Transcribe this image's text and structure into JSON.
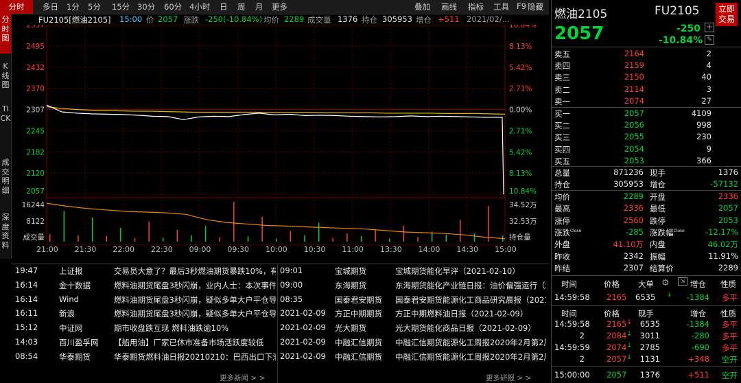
{
  "toolbar": {
    "periods": [
      "分时",
      "多日",
      "1分",
      "5分",
      "15分",
      "30分",
      "60分",
      "4小时",
      "日",
      "周",
      "月",
      "更多"
    ],
    "active_period": "分时",
    "tools": [
      "叠加",
      "画线",
      "指标",
      "工具",
      "F9",
      "隐藏"
    ]
  },
  "sidetabs": [
    "分时图",
    "K线图",
    "TICK",
    "成交明细",
    "深度资料"
  ],
  "infobar": {
    "symbol": "FU2105[燃油2105]",
    "time": "15:00",
    "price_label": "价",
    "price": "2057",
    "change_label": "涨跌",
    "change": "-250(-10.84%)",
    "avg_label": "均价",
    "avg": "2289",
    "volume_label": "成交量",
    "volume": "1376",
    "oi_label": "持仓",
    "oi": "305953",
    "oi_change_label": "增仓",
    "oi_change": "+511",
    "date": "2021/02/..."
  },
  "chart_data": {
    "type": "line",
    "prev_settle": 2307,
    "price_axis": [
      "2557",
      "2495",
      "2432",
      "2370",
      "2307",
      "2245",
      "2182",
      "2120",
      "2057"
    ],
    "pct_axis": [
      "10.84%",
      "8.13%",
      "5.42%",
      "2.71%",
      "0.00%",
      "2.71%",
      "5.42%",
      "8.13%",
      "10.84%"
    ],
    "volume_axis": [
      "16244",
      "8122",
      "成交量"
    ],
    "oi_axis": [
      "34.52万",
      "32.53万",
      "持仓量"
    ],
    "time_labels": [
      "21:00",
      "21:30",
      "22:00",
      "22:30",
      "09:00",
      "09:30",
      "10:00",
      "10:30",
      "11:00",
      "13:30",
      "14:00",
      "14:30",
      "15:00"
    ],
    "series": [
      {
        "values": [
          2320,
          2300,
          2296,
          2294,
          2293,
          2292,
          2290,
          2287,
          2286,
          2277,
          2285,
          2287,
          2286,
          2292,
          2296,
          2291,
          2293,
          2289,
          2290,
          2289,
          2287,
          2286,
          2285,
          2286,
          2288,
          2286,
          2287,
          2286,
          2285,
          2284,
          2284,
          2057
        ]
      },
      {
        "values": [
          2315,
          2310,
          2307,
          2305,
          2304,
          2303,
          2302,
          2302,
          2301,
          2300,
          2299,
          2299,
          2299,
          2299,
          2299,
          2298,
          2298,
          2298,
          2298,
          2297,
          2297,
          2297,
          2297,
          2296,
          2296,
          2296,
          2296,
          2295,
          2295,
          2295,
          2294,
          2293
        ]
      }
    ],
    "volume": [
      3000,
      12500,
      2500,
      9800,
      2200,
      5600,
      1400,
      8200,
      1600,
      4800,
      2500,
      6300,
      1800,
      16244,
      2100,
      10200,
      1200,
      4300,
      2600,
      7700,
      1500,
      3400,
      2200,
      5100,
      1300,
      6400,
      1900,
      4000,
      2800,
      9000,
      3300,
      14500,
      2500
    ],
    "volume_colors": [
      "r",
      "g",
      "r",
      "g",
      "r",
      "g",
      "r",
      "r",
      "g",
      "r",
      "g",
      "g",
      "r",
      "r",
      "g",
      "r",
      "g",
      "r",
      "g",
      "g",
      "r",
      "r",
      "g",
      "r",
      "g",
      "r",
      "r",
      "g",
      "g",
      "r",
      "g",
      "r",
      "g"
    ],
    "open_interest": [
      34.9,
      34.7,
      34.55,
      34.45,
      34.35,
      34.3,
      34.25,
      34.15,
      33.8,
      33.6,
      33.5,
      33.4,
      33.35,
      33.3,
      33.25,
      33.2,
      33.15,
      33.05,
      32.95,
      32.9,
      32.85,
      32.75,
      32.6,
      32.5
    ]
  },
  "news_left": [
    {
      "time": "19:47",
      "source": "上证报",
      "title": "交易员大意了？最后3秒燃油期货暴跌10%，有色…"
    },
    {
      "time": "16:14",
      "source": "金十数据",
      "title": "燃料油期货尾盘3秒闪崩，业内人士：本次事件系…"
    },
    {
      "time": "16:14",
      "source": "Wind",
      "title": "燃料油期货尾盘3秒闪崩，疑似多单大户平仓导致…"
    },
    {
      "time": "16:11",
      "source": "新浪",
      "title": "燃料油期货尾盘3秒闪崩，疑似多单大户平仓导致…"
    },
    {
      "time": "15:12",
      "source": "中证网",
      "title": "期市收盘跌互现 燃料油跌逾10%"
    },
    {
      "time": "14:03",
      "source": "百川盈孚网",
      "title": "【船用油】厂家已休市准备市场活跃度较低"
    },
    {
      "time": "08:54",
      "source": "华泰期货",
      "title": "华泰期货燃料油日报20210210：巴西出口下滑…"
    }
  ],
  "news_left_more": "更多新闻 > >",
  "news_right": [
    {
      "time": "09:01",
      "source": "宝城期货",
      "title": "宝城期货能化早评（2021-02-10）"
    },
    {
      "time": "09:00",
      "source": "东海期货",
      "title": "东海期货能化产业链日报：油价偏强运行（2…"
    },
    {
      "time": "08:35",
      "source": "国泰君安期货",
      "title": "国泰君安期货能源化工商品研究晨报（2021…"
    },
    {
      "time": "2021-02-09",
      "source": "方正中期期货",
      "title": "方正中期燃料油日报（2021-02-09）"
    },
    {
      "time": "2021-02-09",
      "source": "光大期货",
      "title": "光大期货能化商品日报（2021-02-09）"
    },
    {
      "time": "2021-02-09",
      "source": "中融汇信期货",
      "title": "中融汇信期货能源化工周报2020年2月第2周…"
    },
    {
      "time": "2021-02-09",
      "source": "中融汇信期货",
      "title": "中融汇信期货能源化工周报2020年2月第2周…"
    }
  ],
  "news_right_more": "更多研报 > >",
  "quote": {
    "name": "燃油2105",
    "code": "FU2105",
    "trade_button": "立即交易",
    "price": "2057",
    "change": "-250",
    "change_pct": "-10.84%",
    "asks": [
      {
        "label": "卖五",
        "price": "2164",
        "vol": "2"
      },
      {
        "label": "卖四",
        "price": "2159",
        "vol": "4"
      },
      {
        "label": "卖三",
        "price": "2150",
        "vol": "40"
      },
      {
        "label": "卖二",
        "price": "2114",
        "vol": "3"
      },
      {
        "label": "卖一",
        "price": "2074",
        "vol": "27"
      }
    ],
    "bids": [
      {
        "label": "买一",
        "price": "2057",
        "vol": "4109"
      },
      {
        "label": "买二",
        "price": "2056",
        "vol": "998"
      },
      {
        "label": "买三",
        "price": "2055",
        "vol": "230"
      },
      {
        "label": "买四",
        "price": "2054",
        "vol": "9"
      },
      {
        "label": "买五",
        "price": "2053",
        "vol": "366"
      }
    ],
    "stats_top": [
      {
        "l1": "总量",
        "v1": "871236",
        "c1": "white",
        "l2": "现手",
        "v2": "1376",
        "c2": "white"
      },
      {
        "l1": "持仓",
        "v1": "305953",
        "c1": "white",
        "l2": "增仓",
        "v2": "-57132",
        "c2": "green"
      }
    ],
    "stats": [
      {
        "l1": "均价",
        "v1": "2289",
        "c1": "green",
        "l2": "开盘",
        "v2": "2336",
        "c2": "red"
      },
      {
        "l1": "最高",
        "v1": "2336",
        "c1": "red",
        "l2": "最低",
        "v2": "2057",
        "c2": "green"
      },
      {
        "l1": "涨停",
        "v1": "2560",
        "c1": "red",
        "l2": "跌停",
        "v2": "2053",
        "c2": "green"
      },
      {
        "l1": "涨跌",
        "v1": "-285",
        "c1": "green",
        "l2": "涨跌幅",
        "v2": "-12.17%",
        "c2": "green"
      },
      {
        "l1": "外盘",
        "v1": "41.10万",
        "c1": "red",
        "l2": "内盘",
        "v2": "46.02万",
        "c2": "green"
      },
      {
        "l1": "昨收",
        "v1": "2342",
        "c1": "white",
        "l2": "振幅",
        "v2": "11.91%",
        "c2": "white"
      },
      {
        "l1": "昨结",
        "v1": "2307",
        "c1": "white",
        "l2": "结算价",
        "v2": "2289",
        "c2": "white"
      }
    ],
    "close_sup": "Close",
    "tick_header": [
      "时间",
      "价格",
      "大单",
      "增仓",
      "性质"
    ],
    "big_order": {
      "time": "14:59:58",
      "price": "2165",
      "vol": "6535",
      "oi": "-1384",
      "nature": "多平"
    },
    "ticks_header": [
      "时间",
      "价格",
      "现手",
      "增仓",
      "性质"
    ],
    "ticks": [
      {
        "time": "14:59:58",
        "price": "2165",
        "vol": "6535",
        "oi": "-1384",
        "nature": "多平",
        "oc": "red",
        "nc": "red"
      },
      {
        "time": "2",
        "price": "2084",
        "vol": "3011",
        "oi": "-280",
        "nature": "多平",
        "oc": "red",
        "nc": "red"
      },
      {
        "time": "14:59:59",
        "price": "2074",
        "vol": "2785",
        "oi": "-690",
        "nature": "多平",
        "oc": "red",
        "nc": "red"
      },
      {
        "time": "2",
        "price": "2057",
        "vol": "1131",
        "oi": "+348",
        "nature": "空开",
        "oc": "red",
        "nc": "green"
      },
      {
        "time": "15:00:00",
        "price": "2057",
        "vol": "1376",
        "oi": "+511",
        "nature": "空开",
        "oc": "red",
        "nc": "green"
      }
    ]
  },
  "colors": {
    "up": "#ff3b3b",
    "down": "#00d13a",
    "price_line": "#ffffff",
    "avg_line": "#e6b800",
    "oi_line": "#e68a00",
    "grid": "#5a0000"
  }
}
